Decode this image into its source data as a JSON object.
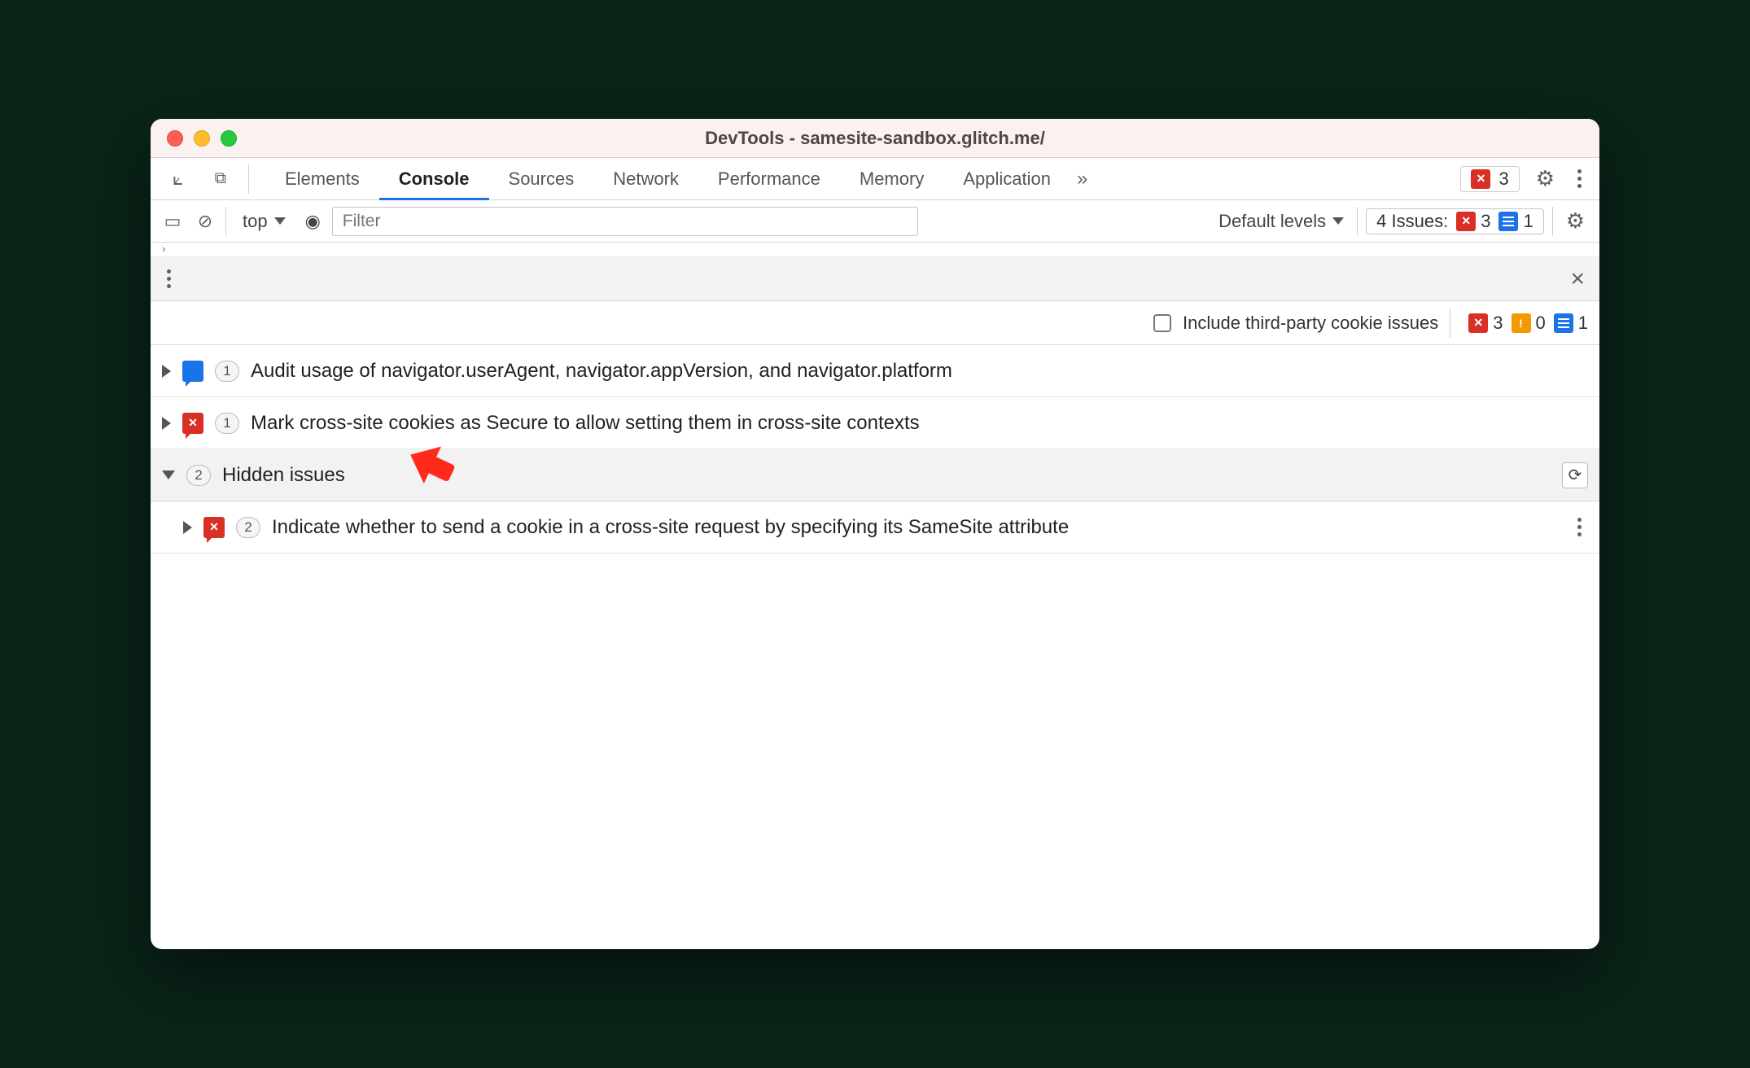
{
  "window": {
    "title": "DevTools - samesite-sandbox.glitch.me/"
  },
  "tabs": {
    "items": [
      "Elements",
      "Console",
      "Sources",
      "Network",
      "Performance",
      "Memory",
      "Application"
    ],
    "active": "Console"
  },
  "tab_error_badge": {
    "count": "3"
  },
  "console_toolbar": {
    "context": "top",
    "filter_placeholder": "Filter",
    "levels_label": "Default levels",
    "issues_label": "4 Issues:",
    "issues_errors": "3",
    "issues_info": "1"
  },
  "issues_filter": {
    "checkbox_label": "Include third-party cookie issues",
    "counts": {
      "errors": "3",
      "warnings": "0",
      "info": "1"
    }
  },
  "issues_list": [
    {
      "type": "info",
      "count": "1",
      "title": "Audit usage of navigator.userAgent, navigator.appVersion, and navigator.platform"
    },
    {
      "type": "error",
      "count": "1",
      "title": "Mark cross-site cookies as Secure to allow setting them in cross-site contexts"
    }
  ],
  "hidden_group": {
    "count": "2",
    "label": "Hidden issues",
    "items": [
      {
        "type": "error",
        "count": "2",
        "title": "Indicate whether to send a cookie in a cross-site request by specifying its SameSite attribute"
      }
    ]
  }
}
